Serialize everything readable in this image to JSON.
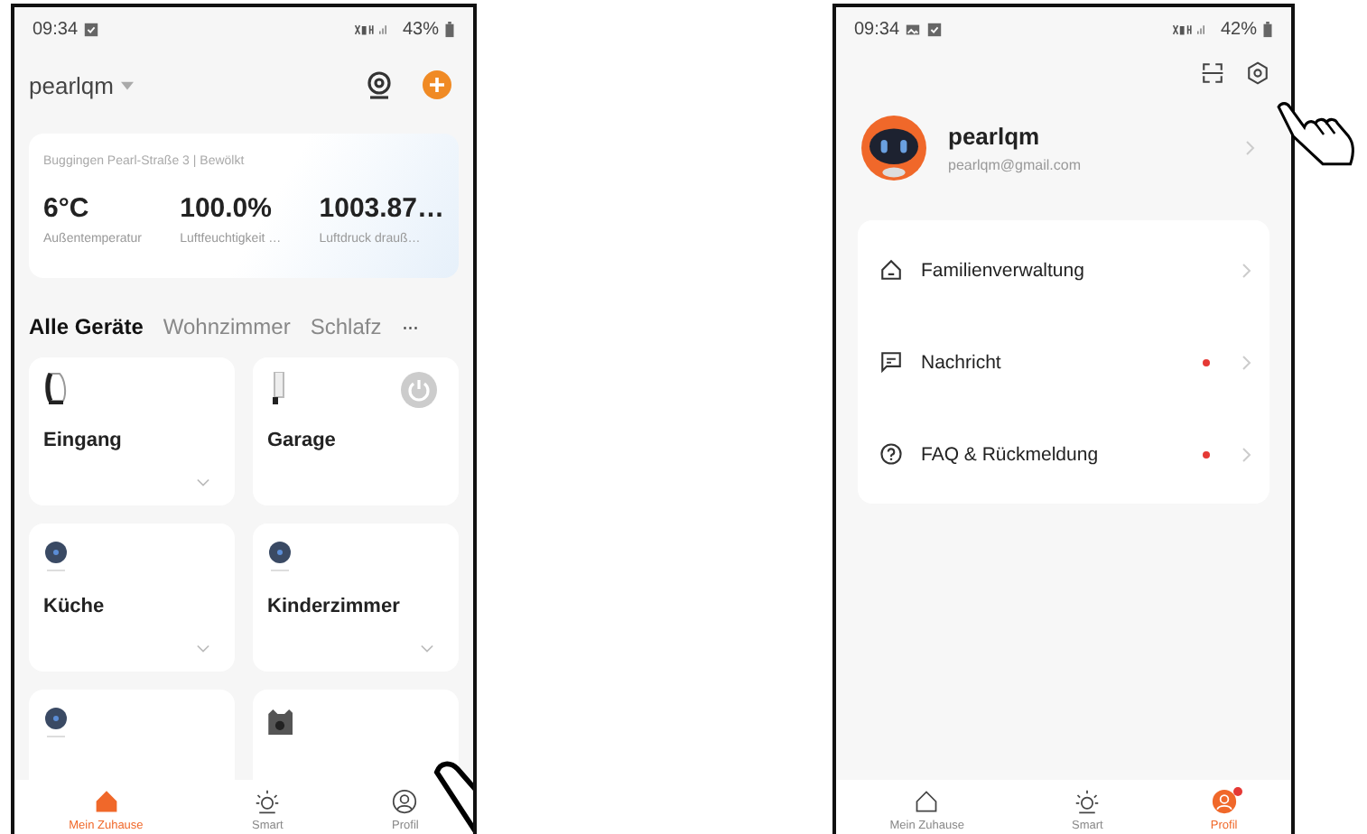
{
  "home_screen": {
    "status_bar": {
      "time": "09:34",
      "notification_icons": [
        {
          "kind": "checkbox"
        }
      ],
      "battery": "43%"
    },
    "home_name": "pearlqm",
    "weather": {
      "location": "Buggingen Pearl-Straße 3 | Bewölkt",
      "stats": [
        {
          "value": "6°C",
          "label": "Außentemperatur"
        },
        {
          "value": "100.0%",
          "label": "Luftfeuchtigkeit …"
        },
        {
          "value": "1003.87…",
          "label": "Luftdruck drauß…"
        }
      ]
    },
    "room_tabs": [
      {
        "label": "Alle Geräte",
        "selected": true
      },
      {
        "label": "Wohnzimmer",
        "selected": false
      },
      {
        "label": "Schlafz",
        "selected": false
      }
    ],
    "more_tabs": "···",
    "devices": [
      {
        "name": "Eingang",
        "kind": "dome",
        "power_button": false,
        "expandable": true
      },
      {
        "name": "Garage",
        "kind": "floodlight",
        "power_button": true,
        "expandable": false
      },
      {
        "name": "Küche",
        "kind": "round",
        "power_button": false,
        "expandable": true
      },
      {
        "name": "Kinderzimmer",
        "kind": "round",
        "power_button": false,
        "expandable": true
      },
      {
        "kind": "round"
      },
      {
        "kind": "cube"
      }
    ],
    "nav": [
      {
        "label": "Mein Zuhause",
        "kind": "home",
        "selected": true,
        "badge": false
      },
      {
        "label": "Smart",
        "kind": "sun",
        "selected": false,
        "badge": false
      },
      {
        "label": "Profil",
        "kind": "profile",
        "selected": false,
        "badge": false
      }
    ]
  },
  "profile_screen": {
    "status_bar": {
      "time": "09:34",
      "notification_icons": [
        {
          "kind": "image"
        },
        {
          "kind": "checkbox"
        }
      ],
      "battery": "42%"
    },
    "user": {
      "name": "pearlqm",
      "email": "pearlqm@gmail.com"
    },
    "menu": [
      {
        "label": "Familienverwaltung",
        "kind": "home",
        "badge": false
      },
      {
        "label": "Nachricht",
        "kind": "message",
        "badge": true
      },
      {
        "label": "FAQ & Rückmeldung",
        "kind": "question",
        "badge": true
      }
    ],
    "nav": [
      {
        "label": "Mein Zuhause",
        "kind": "home",
        "selected": false,
        "badge": false
      },
      {
        "label": "Smart",
        "kind": "sun",
        "selected": false,
        "badge": false
      },
      {
        "label": "Profil",
        "kind": "profile",
        "selected": true,
        "badge": true
      }
    ]
  }
}
